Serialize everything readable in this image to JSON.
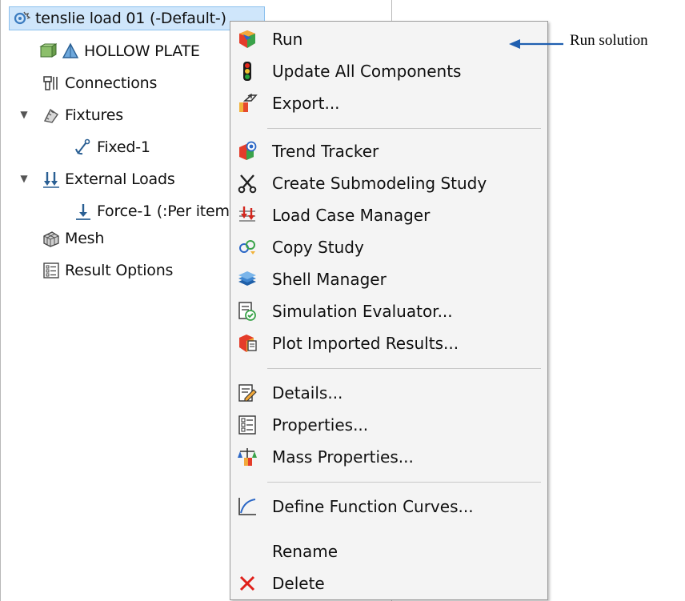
{
  "tree": {
    "root": "tenslie load 01 (-Default-)",
    "items": [
      {
        "label": "HOLLOW PLATE",
        "icon": "part-icon"
      },
      {
        "label": "Connections",
        "icon": "connections-icon"
      },
      {
        "label": "Fixtures",
        "icon": "fixtures-icon"
      },
      {
        "label": "Fixed-1",
        "icon": "anchor-icon"
      },
      {
        "label": "External Loads",
        "icon": "external-loads-icon"
      },
      {
        "label": "Force-1 (:Per item",
        "icon": "force-arrow-icon"
      },
      {
        "label": "Mesh",
        "icon": "mesh-icon"
      },
      {
        "label": "Result Options",
        "icon": "result-options-icon"
      }
    ]
  },
  "menu": {
    "items": [
      {
        "label": "Run",
        "icon": "run-icon"
      },
      {
        "label": "Update All Components",
        "icon": "traffic-light-icon"
      },
      {
        "label": "Export...",
        "icon": "export-icon"
      },
      {
        "label": "Trend Tracker",
        "icon": "trend-tracker-icon"
      },
      {
        "label": "Create Submodeling Study",
        "icon": "scissors-icon"
      },
      {
        "label": "Load Case Manager",
        "icon": "load-case-icon"
      },
      {
        "label": "Copy Study",
        "icon": "copy-study-icon"
      },
      {
        "label": "Shell Manager",
        "icon": "shell-icon"
      },
      {
        "label": "Simulation Evaluator...",
        "icon": "evaluator-icon"
      },
      {
        "label": "Plot Imported Results...",
        "icon": "plot-results-icon"
      },
      {
        "label": "Details...",
        "icon": "details-icon"
      },
      {
        "label": "Properties...",
        "icon": "properties-icon"
      },
      {
        "label": "Mass Properties...",
        "icon": "mass-properties-icon"
      },
      {
        "label": "Define Function Curves...",
        "icon": "curve-icon"
      },
      {
        "label": "Rename",
        "icon": ""
      },
      {
        "label": "Delete",
        "icon": "delete-x-icon"
      }
    ]
  },
  "annotation": {
    "text": "Run solution"
  },
  "colors": {
    "selection": "#cfe6fb",
    "menu_bg": "#f4f4f4",
    "arrow": "#1f5fb0",
    "delete": "#e0201a"
  }
}
